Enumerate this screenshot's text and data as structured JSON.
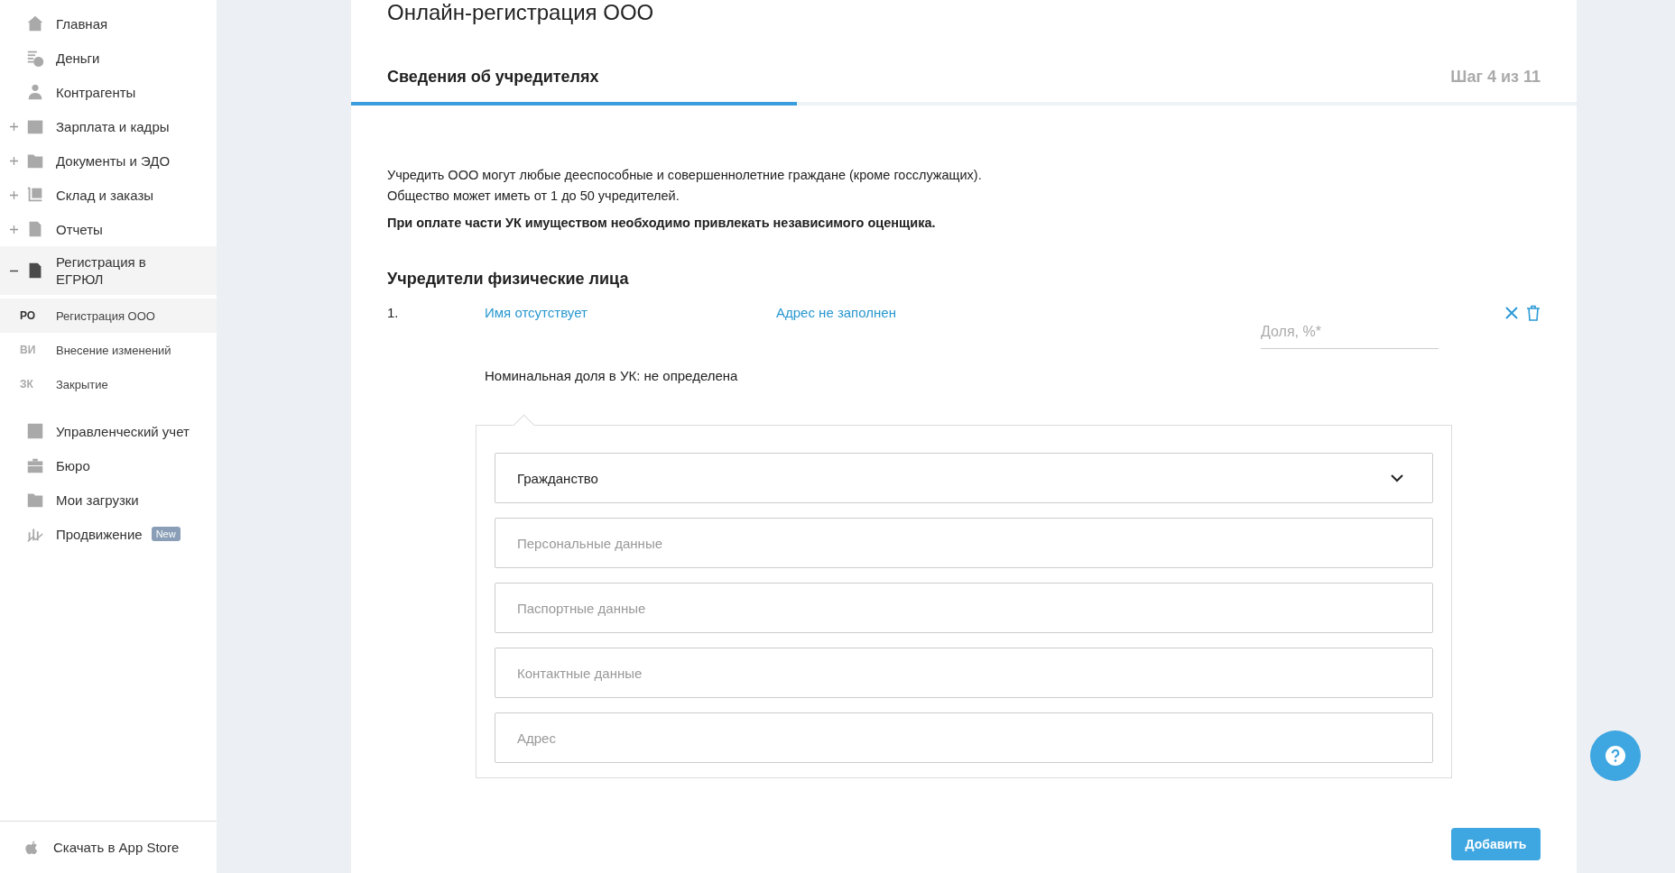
{
  "sidebar": {
    "items": [
      {
        "label": "Главная"
      },
      {
        "label": "Деньги"
      },
      {
        "label": "Контрагенты"
      },
      {
        "label": "Зарплата и кадры",
        "expanded": false
      },
      {
        "label": "Документы и ЭДО",
        "expanded": false
      },
      {
        "label": "Склад и заказы",
        "expanded": false
      },
      {
        "label": "Отчеты",
        "expanded": false
      },
      {
        "label": "Регистрация в ЕГРЮЛ",
        "expanded": true,
        "children": [
          {
            "abbr": "РО",
            "label": "Регистрация ООО",
            "selected": true
          },
          {
            "abbr": "ВИ",
            "label": "Внесение изменений",
            "selected": false
          },
          {
            "abbr": "ЗК",
            "label": "Закрытие",
            "selected": false
          }
        ]
      },
      {
        "label": "Управленческий учет"
      },
      {
        "label": "Бюро"
      },
      {
        "label": "Мои загрузки"
      },
      {
        "label": "Продвижение",
        "badge": "New"
      }
    ],
    "app_store": "Скачать в App Store"
  },
  "page": {
    "title": "Онлайн-регистрация ООО",
    "step": {
      "title": "Сведения об учредителях",
      "counter": "Шаг 4 из 11",
      "level": 0.364
    },
    "info": [
      "Учредить ООО могут любые дееспособные и совершеннолетние граждане (кроме госслужащих).",
      "Общество может иметь от 1 до 50 учредителей."
    ],
    "note": "При оплате части УК имуществом необходимо привлекать независимого оценщика.",
    "section_title": "Учредители физические лица",
    "founders": [
      {
        "number": "1.",
        "name": "Имя отсутствует",
        "address": "Адрес не заполнен",
        "share_placeholder": "Доля, %*",
        "nominal": "Номинальная доля в УК: не определена",
        "fields": [
          {
            "kind": "select",
            "label": "Гражданство"
          },
          {
            "kind": "section",
            "label": "Персональные данные"
          },
          {
            "kind": "section",
            "label": "Паспортные данные"
          },
          {
            "kind": "section",
            "label": "Контактные данные"
          },
          {
            "kind": "section",
            "label": "Адрес"
          }
        ]
      }
    ],
    "add_button": "Добавить"
  }
}
